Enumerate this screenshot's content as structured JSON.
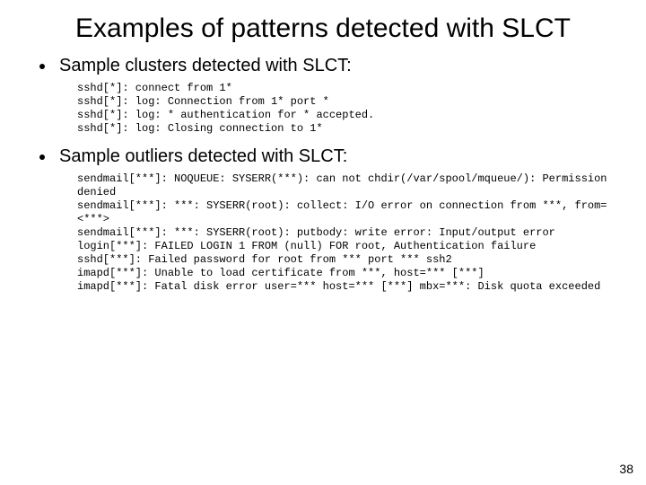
{
  "title": "Examples of patterns detected with SLCT",
  "sections": [
    {
      "heading": "Sample clusters detected with SLCT:",
      "code": "sshd[*]: connect from 1*\nsshd[*]: log: Connection from 1* port *\nsshd[*]: log: * authentication for * accepted.\nsshd[*]: log: Closing connection to 1*"
    },
    {
      "heading": "Sample outliers detected with SLCT:",
      "code": "sendmail[***]: NOQUEUE: SYSERR(***): can not chdir(/var/spool/mqueue/): Permission denied\nsendmail[***]: ***: SYSERR(root): collect: I/O error on connection from ***, from=<***>\nsendmail[***]: ***: SYSERR(root): putbody: write error: Input/output error\nlogin[***]: FAILED LOGIN 1 FROM (null) FOR root, Authentication failure\nsshd[***]: Failed password for root from *** port *** ssh2\nimapd[***]: Unable to load certificate from ***, host=*** [***]\nimapd[***]: Fatal disk error user=*** host=*** [***] mbx=***: Disk quota exceeded"
    }
  ],
  "page_number": "38"
}
